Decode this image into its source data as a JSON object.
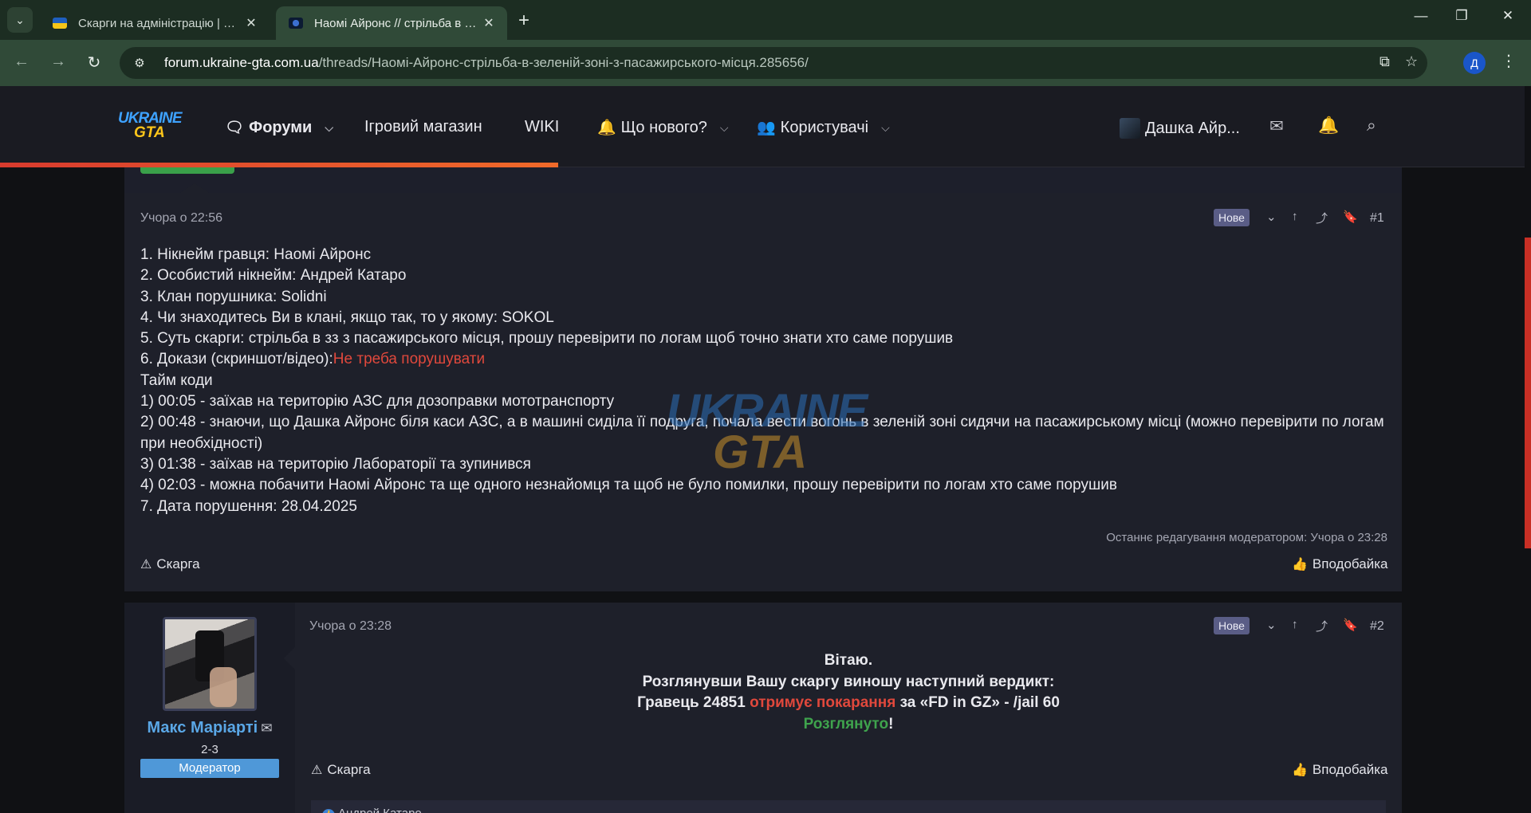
{
  "browser": {
    "tabs": [
      {
        "title": "Скарги на адміністрацію | UKRAINE GTA",
        "active": false
      },
      {
        "title": "Наомі Айронс // стрільба в зеленій зоні",
        "active": true
      }
    ],
    "url_host": "forum.ukraine-gta.com.ua",
    "url_path": "/threads/Наомі-Айронс-стрільба-в-зеленій-зоні-з-пасажирського-місця.285656/",
    "profile_initial": "Д"
  },
  "site": {
    "logo_top": "UKRAINE",
    "logo_bottom": "GTA",
    "nav": {
      "forums": "Форуми",
      "shop": "Ігровий магазин",
      "wiki": "WIKI",
      "whats_new": "Що нового?",
      "users": "Користувачі"
    },
    "user_name": "Дашка Айр..."
  },
  "post1": {
    "time": "Учора о 22:56",
    "badge": "Нове",
    "number": "#1",
    "lines": [
      "1. Нікнейм гравця: Наомі Айронс",
      "2. Особистий нікнейм: Андрей Катаро",
      "3. Клан порушника: Solidni",
      "4. Чи знаходитесь Ви в клані, якщо так, то у якому: SOKOL",
      "5. Суть скарги: стрільба в зз з пасажирського місця, прошу перевірити по логам щоб точно знати хто саме порушив"
    ],
    "evidence_label": "6. Докази (скриншот/відео):",
    "evidence_value": "Не треба порушувати",
    "timecodes_title": "Тайм коди",
    "timecodes": [
      "1) 00:05 - заїхав на територію АЗС для дозоправки мототранспорту",
      "2) 00:48 - знаючи, що Дашка Айронс біля каси АЗС, а в машині сиділа її подруга, почала вести вогонь в зеленій зоні сидячи на пасажирському місці (можно перевірити по логам при необхідності)",
      "3) 01:38 - заїхав на територію Лабораторії та зупинився",
      "4) 02:03 - можна побачити Наомі Айронс та ще одного незнайомця та щоб не було помилки, прошу перевірити по логам хто саме порушив"
    ],
    "date_line": "7. Дата порушення: 28.04.2025",
    "edited_note": "Останнє редагування модератором: Учора о 23:28",
    "report_label": "Скарга",
    "like_label": "Вподобайка"
  },
  "watermark": {
    "top": "UKRAINE",
    "bottom": "GTA"
  },
  "post2": {
    "author": "Макс Маріарті",
    "author_title": "2-3",
    "author_role": "Модератор",
    "time": "Учора о 23:28",
    "badge": "Нове",
    "number": "#2",
    "greeting": "Вітаю.",
    "verdict_intro": "Розглянувши Вашу скаргу виношу наступний вердикт:",
    "verdict_player": "Гравець 24851",
    "verdict_penalty": "отримує покарання",
    "verdict_rest": "за «FD in GZ» - /jail 60",
    "status": "Розглянуто",
    "status_suffix": "!",
    "report_label": "Скарга",
    "like_label": "Вподобайка",
    "liked_by": "Андрей Катаро"
  },
  "colors": {
    "accent_red": "#e0483c",
    "accent_green": "#3fa34d",
    "moderator_blue": "#4f98d8",
    "username_blue": "#5aa7e6",
    "browser_green": "#304a38"
  }
}
